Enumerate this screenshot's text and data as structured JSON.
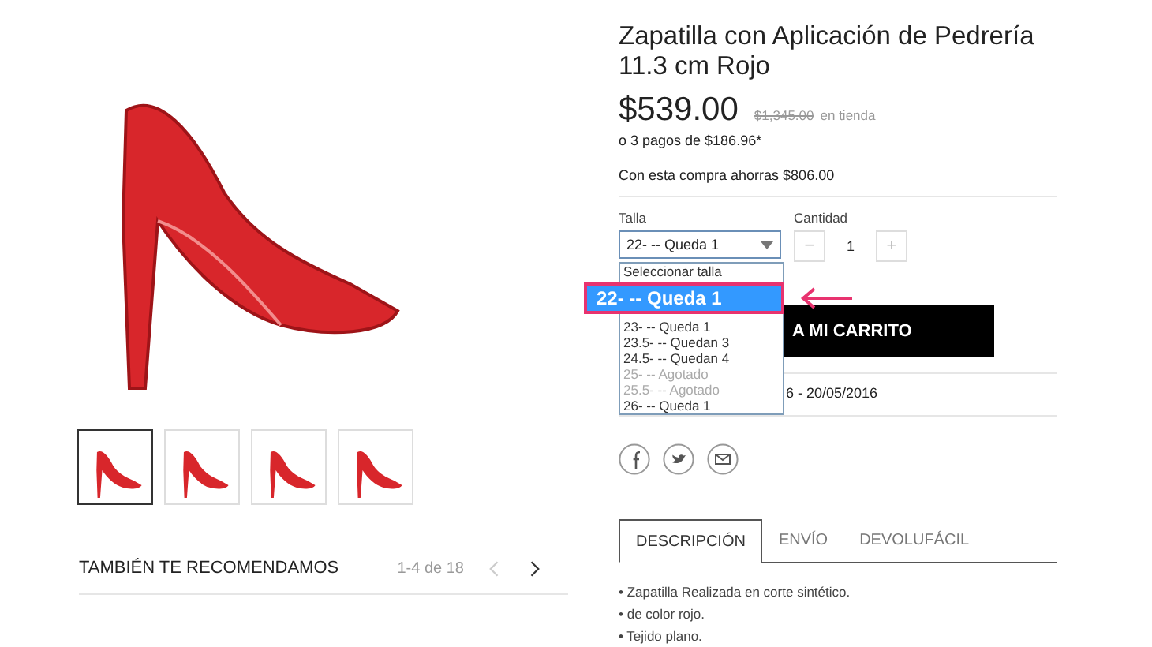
{
  "product": {
    "title": "Zapatilla con Aplicación de Pedrería 11.3 cm Rojo",
    "price": "$539.00",
    "old_price": "$1,345.00",
    "old_price_note": "en tienda",
    "installments": "o 3 pagos de $186.96*",
    "savings": "Con esta compra ahorras $806.00"
  },
  "thumbnails": [
    {
      "selected": true
    },
    {
      "selected": false
    },
    {
      "selected": false
    },
    {
      "selected": false
    }
  ],
  "recommendations": {
    "title": "TAMBIÉN TE RECOMENDAMOS",
    "range": "1-4 de 18"
  },
  "size": {
    "label": "Talla",
    "value": "22- -- Queda 1",
    "options": [
      {
        "label": "Seleccionar talla",
        "selected": false,
        "disabled": false
      },
      {
        "label": "22- -- Queda 1",
        "selected": true,
        "disabled": false
      },
      {
        "label": "23- -- Queda 1",
        "selected": false,
        "disabled": false
      },
      {
        "label": "23.5- -- Quedan 3",
        "selected": false,
        "disabled": false
      },
      {
        "label": "24.5- -- Quedan 4",
        "selected": false,
        "disabled": false
      },
      {
        "label": "25- -- Agotado",
        "selected": false,
        "disabled": true
      },
      {
        "label": "25.5- -- Agotado",
        "selected": false,
        "disabled": true
      },
      {
        "label": "26- -- Queda 1",
        "selected": false,
        "disabled": false
      }
    ]
  },
  "quantity": {
    "label": "Cantidad",
    "minus": "−",
    "value": "1",
    "plus": "+"
  },
  "add_to_cart": "A MI CARRITO",
  "delivery": "6 - 20/05/2016",
  "tabs": [
    {
      "label": "DESCRIPCIÓN",
      "selected": true
    },
    {
      "label": "ENVÍO",
      "selected": false
    },
    {
      "label": "DEVOLUFÁCIL",
      "selected": false
    }
  ],
  "description": [
    "• Zapatilla Realizada en corte sintético.",
    "• de color rojo.",
    "• Tejido plano."
  ]
}
